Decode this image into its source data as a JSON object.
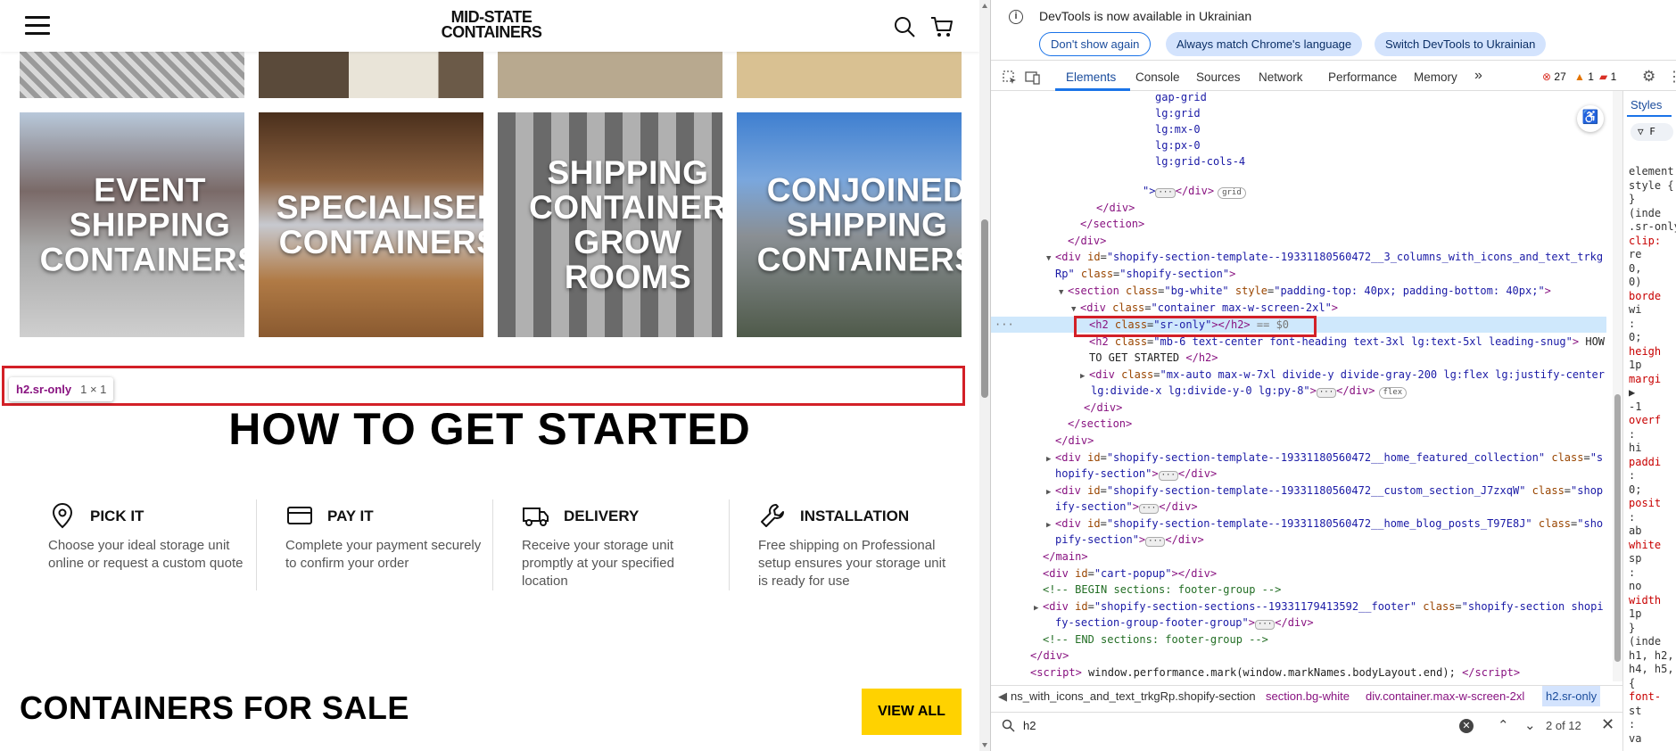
{
  "site": {
    "logo_line1": "MID-STATE",
    "logo_line2": "CONTAINERS",
    "tiles": [
      {
        "label": "EVENT\nSHIPPING\nCONTAINERS",
        "bg": "#8c8c8c"
      },
      {
        "label": "SPECIALISED\nCONTAINERS",
        "bg": "#6b4a2e"
      },
      {
        "label": "SHIPPING\nCONTAINER\nGROW\nROOMS",
        "bg": "#707070"
      },
      {
        "label": "CONJOINED\nSHIPPING\nCONTAINERS",
        "bg": "#5f7a99"
      }
    ],
    "highlight_tag": {
      "selector": "h2.sr-only",
      "size": "1 × 1"
    },
    "section_title": "HOW TO GET STARTED",
    "steps": [
      {
        "title": "PICK IT",
        "desc": "Choose your ideal storage unit online or request a custom quote",
        "icon": "location-pin-icon"
      },
      {
        "title": "PAY IT",
        "desc": "Complete your payment securely to confirm your order",
        "icon": "credit-card-icon"
      },
      {
        "title": "DELIVERY",
        "desc": "Receive your storage unit promptly at your specified location",
        "icon": "truck-icon"
      },
      {
        "title": "INSTALLATION",
        "desc": "Free shipping on Professional setup ensures your storage unit is ready for use",
        "icon": "wrench-icon"
      }
    ],
    "for_sale_title": "CONTAINERS FOR SALE",
    "view_all_label": "VIEW ALL",
    "accent_color": "#ffd200"
  },
  "devtools": {
    "notification": "DevTools is now available in Ukrainian",
    "btn_dont_show": "Don't show again",
    "btn_match": "Always match Chrome's language",
    "btn_switch": "Switch DevTools to Ukrainian",
    "tabs": [
      "Elements",
      "Console",
      "Sources",
      "Network",
      "Performance",
      "Memory"
    ],
    "more_tabs": "»",
    "errors": "27",
    "warnings": "1",
    "issues": "1",
    "styles_tab": "Styles",
    "breadcrumbs": [
      "ns_with_icons_and_text_trkgRp.shopify-section",
      "section.bg-white",
      "div.container.max-w-screen-2xl",
      "h2.sr-only"
    ],
    "search_value": "h2",
    "search_count": "2 of 12",
    "dom": {
      "l1": "gap-grid",
      "l2": "lg:grid",
      "l3": "lg:mx-0",
      "l4": "lg:px-0",
      "l5": "lg:grid-cols-4",
      "grid_pill": "grid",
      "flex_pill": "flex",
      "section_id_a": "\"shopify-section-template--19331180560472__3_columns_with_icons_and_text_trkg",
      "section_id_b": "Rp\"",
      "shopify_section": "\"shopify-section\"",
      "section_class": "\"bg-white\"",
      "section_style": "\"padding-top: 40px; padding-bottom: 40px;\"",
      "container_class": "\"container max-w-screen-2xl\"",
      "sr_class": "\"sr-only\"",
      "sel_marker": " == $0",
      "h2_class": "\"mb-6 text-center font-heading text-3xl lg:text-5xl leading-snug\"",
      "h2_text_a": " HOW",
      "h2_text_b": "TO GET STARTED ",
      "div_class": "\"mx-auto max-w-7xl divide-y divide-gray-200 lg:flex lg:justify-center",
      "div_class_b": "lg:divide-x lg:divide-y-0 lg:py-8\"",
      "fc_id": "\"shopify-section-template--19331180560472__home_featured_collection\"",
      "fc_tail": "hopify-section\"",
      "cs_id": "\"shopify-section-template--19331180560472__custom_section_J7zxqW\"",
      "cs_tail": "ify-section\"",
      "bp_id": "\"shopify-section-template--19331180560472__home_blog_posts_T97E8J\"",
      "bp_tail": "pify-section\"",
      "cart_id": "\"cart-popup\"",
      "cmt_begin": "<!-- BEGIN sections: footer-group -->",
      "footer_id": "\"shopify-section-sections--19331179413592__footer\"",
      "footer_class_a": "\"shopify-section shopi",
      "footer_class_b": "fy-section-group-footer-group\"",
      "cmt_end": "<!-- END sections: footer-group -->",
      "script_text": " window.performance.mark(window.markNames.bodyLayout.end); "
    },
    "styles_lines": [
      "element",
      "style {",
      "}",
      "(inde",
      ".sr-only",
      "clip:",
      "re",
      "0,",
      "0)",
      "borde",
      "wi",
      ":",
      "0;",
      "heigh",
      "1p",
      "margi",
      "▶",
      "-1",
      "overf",
      ":",
      "hi",
      "paddi",
      ":",
      "0;",
      "posit",
      ":",
      "ab",
      "white",
      "sp",
      ":",
      "no",
      "width",
      "1p",
      "}",
      "(inde",
      "h1, h2,",
      "h4, h5,",
      "{",
      "font-",
      "st",
      ":",
      "va"
    ]
  }
}
